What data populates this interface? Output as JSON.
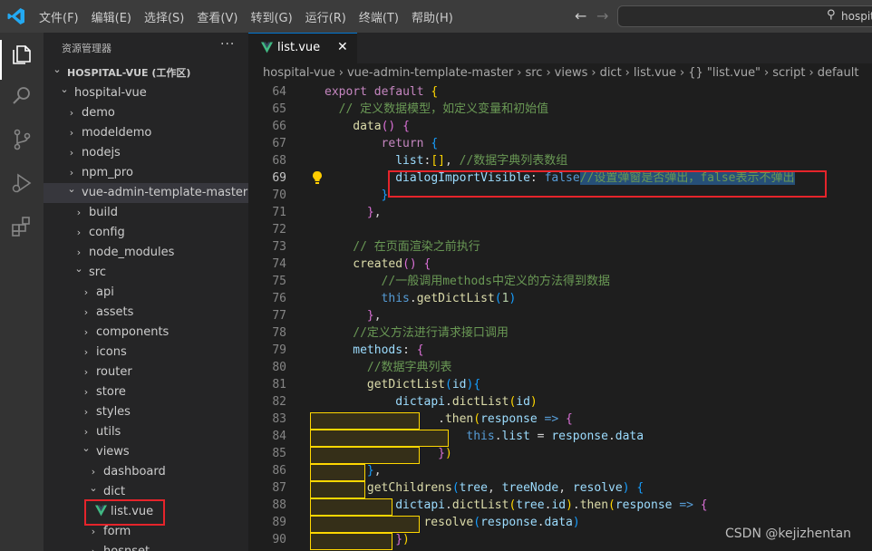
{
  "menu": {
    "items": [
      "文件(F)",
      "编辑(E)",
      "选择(S)",
      "查看(V)",
      "转到(G)",
      "运行(R)",
      "终端(T)",
      "帮助(H)"
    ]
  },
  "search": {
    "text": "hospit"
  },
  "sidebar": {
    "header": "资源管理器",
    "items": [
      {
        "label": "HOSPITAL-VUE (工作区)",
        "depth": 0,
        "expanded": true,
        "root": true
      },
      {
        "label": "hospital-vue",
        "depth": 1,
        "expanded": true
      },
      {
        "label": "demo",
        "depth": 2,
        "expanded": false
      },
      {
        "label": "modeldemo",
        "depth": 2,
        "expanded": false
      },
      {
        "label": "nodejs",
        "depth": 2,
        "expanded": false
      },
      {
        "label": "npm_pro",
        "depth": 2,
        "expanded": false
      },
      {
        "label": "vue-admin-template-master",
        "depth": 2,
        "expanded": true,
        "selected": true
      },
      {
        "label": "build",
        "depth": 3,
        "expanded": false
      },
      {
        "label": "config",
        "depth": 3,
        "expanded": false
      },
      {
        "label": "node_modules",
        "depth": 3,
        "expanded": false
      },
      {
        "label": "src",
        "depth": 3,
        "expanded": true
      },
      {
        "label": "api",
        "depth": 4,
        "expanded": false
      },
      {
        "label": "assets",
        "depth": 4,
        "expanded": false
      },
      {
        "label": "components",
        "depth": 4,
        "expanded": false
      },
      {
        "label": "icons",
        "depth": 4,
        "expanded": false
      },
      {
        "label": "router",
        "depth": 4,
        "expanded": false
      },
      {
        "label": "store",
        "depth": 4,
        "expanded": false
      },
      {
        "label": "styles",
        "depth": 4,
        "expanded": false
      },
      {
        "label": "utils",
        "depth": 4,
        "expanded": false
      },
      {
        "label": "views",
        "depth": 4,
        "expanded": true
      },
      {
        "label": "dashboard",
        "depth": 5,
        "expanded": false
      },
      {
        "label": "dict",
        "depth": 5,
        "expanded": true
      },
      {
        "label": "list.vue",
        "depth": 6,
        "file": true
      },
      {
        "label": "form",
        "depth": 5,
        "expanded": false
      },
      {
        "label": "hosnset",
        "depth": 5,
        "expanded": false
      }
    ]
  },
  "tab": {
    "label": "list.vue",
    "close": "✕"
  },
  "breadcrumbs": [
    "hospital-vue",
    "›",
    "vue-admin-template-master",
    "›",
    "src",
    "›",
    "views",
    "›",
    "dict",
    "›",
    "list.vue",
    "›",
    "{} \"list.vue\"",
    "›",
    "script",
    "›",
    "default"
  ],
  "code": {
    "current_line": 69,
    "lines": [
      {
        "n": "64",
        "tokens": [
          [
            "kw",
            "export"
          ],
          [
            "pun",
            " "
          ],
          [
            "kw",
            "default"
          ],
          [
            "pun",
            " "
          ],
          [
            "br1",
            "{"
          ]
        ],
        "indent": 0
      },
      {
        "n": "65",
        "tokens": [
          [
            "cm",
            "// 定义数据模型，如定义变量和初始值"
          ]
        ],
        "indent": 2
      },
      {
        "n": "66",
        "tokens": [
          [
            "fn",
            "data"
          ],
          [
            "br2",
            "()"
          ],
          [
            "pun",
            " "
          ],
          [
            "br2",
            "{"
          ]
        ],
        "indent": 4
      },
      {
        "n": "67",
        "tokens": [
          [
            "kw",
            "return"
          ],
          [
            "pun",
            " "
          ],
          [
            "br3",
            "{"
          ]
        ],
        "indent": 8
      },
      {
        "n": "68",
        "tokens": [
          [
            "var",
            "list"
          ],
          [
            "pun",
            ":"
          ],
          [
            "br1",
            "[]"
          ],
          [
            "pun",
            ", "
          ],
          [
            "cm",
            "//数据字典列表数组"
          ]
        ],
        "indent": 10
      },
      {
        "n": "69",
        "tokens": [
          [
            "var",
            "dialogImportVisible"
          ],
          [
            "pun",
            ": "
          ],
          [
            "kw2",
            "false"
          ],
          [
            "cm sel-txt",
            "//设置弹窗是否弹出，false表示不弹出"
          ]
        ],
        "indent": 10
      },
      {
        "n": "70",
        "tokens": [
          [
            "br3",
            "}"
          ]
        ],
        "indent": 8
      },
      {
        "n": "71",
        "tokens": [
          [
            "br2",
            "}"
          ],
          [
            "pun",
            ","
          ]
        ],
        "indent": 6
      },
      {
        "n": "72",
        "tokens": [],
        "indent": 0
      },
      {
        "n": "73",
        "tokens": [
          [
            "cm",
            "// 在页面渲染之前执行"
          ]
        ],
        "indent": 4
      },
      {
        "n": "74",
        "tokens": [
          [
            "fn",
            "created"
          ],
          [
            "br2",
            "()"
          ],
          [
            "pun",
            " "
          ],
          [
            "br2",
            "{"
          ]
        ],
        "indent": 4
      },
      {
        "n": "75",
        "tokens": [
          [
            "cm",
            "//一般调用methods中定义的方法得到数据"
          ]
        ],
        "indent": 8
      },
      {
        "n": "76",
        "tokens": [
          [
            "kw2",
            "this"
          ],
          [
            "pun",
            "."
          ],
          [
            "fn",
            "getDictList"
          ],
          [
            "br3",
            "("
          ],
          [
            "num",
            "1"
          ],
          [
            "br3",
            ")"
          ]
        ],
        "indent": 8
      },
      {
        "n": "77",
        "tokens": [
          [
            "br2",
            "}"
          ],
          [
            "pun",
            ","
          ]
        ],
        "indent": 6
      },
      {
        "n": "78",
        "tokens": [
          [
            "cm",
            "//定义方法进行请求接口调用"
          ]
        ],
        "indent": 4
      },
      {
        "n": "79",
        "tokens": [
          [
            "var",
            "methods"
          ],
          [
            "pun",
            ": "
          ],
          [
            "br2",
            "{"
          ]
        ],
        "indent": 4
      },
      {
        "n": "80",
        "tokens": [
          [
            "cm",
            "//数据字典列表"
          ]
        ],
        "indent": 6
      },
      {
        "n": "81",
        "tokens": [
          [
            "fn",
            "getDictList"
          ],
          [
            "br3",
            "("
          ],
          [
            "var",
            "id"
          ],
          [
            "br3",
            ")"
          ],
          [
            "br3",
            "{"
          ]
        ],
        "indent": 6
      },
      {
        "n": "82",
        "tokens": [
          [
            "var",
            "dictapi"
          ],
          [
            "pun",
            "."
          ],
          [
            "fn",
            "dictList"
          ],
          [
            "br1",
            "("
          ],
          [
            "var",
            "id"
          ],
          [
            "br1",
            ")"
          ]
        ],
        "indent": 10
      },
      {
        "n": "83",
        "tokens": [
          [
            "pun",
            "."
          ],
          [
            "fn",
            "then"
          ],
          [
            "br1",
            "("
          ],
          [
            "var",
            "response"
          ],
          [
            "pun",
            " "
          ],
          [
            "kw2",
            "=>"
          ],
          [
            "pun",
            " "
          ],
          [
            "br2",
            "{"
          ]
        ],
        "indent": 16
      },
      {
        "n": "84",
        "tokens": [
          [
            "kw2",
            "this"
          ],
          [
            "pun",
            "."
          ],
          [
            "var",
            "list"
          ],
          [
            "pun",
            " = "
          ],
          [
            "var",
            "response"
          ],
          [
            "pun",
            "."
          ],
          [
            "var",
            "data"
          ]
        ],
        "indent": 20
      },
      {
        "n": "85",
        "tokens": [
          [
            "br2",
            "}"
          ],
          [
            "br1",
            ")"
          ]
        ],
        "indent": 16
      },
      {
        "n": "86",
        "tokens": [
          [
            "br3",
            "}"
          ],
          [
            "pun",
            ","
          ]
        ],
        "indent": 6
      },
      {
        "n": "87",
        "tokens": [
          [
            "fn",
            "getChildrens"
          ],
          [
            "br3",
            "("
          ],
          [
            "var",
            "tree"
          ],
          [
            "pun",
            ", "
          ],
          [
            "var",
            "treeNode"
          ],
          [
            "pun",
            ", "
          ],
          [
            "var",
            "resolve"
          ],
          [
            "br3",
            ")"
          ],
          [
            "pun",
            " "
          ],
          [
            "br3",
            "{"
          ]
        ],
        "indent": 6
      },
      {
        "n": "88",
        "tokens": [
          [
            "var",
            "dictapi"
          ],
          [
            "pun",
            "."
          ],
          [
            "fn",
            "dictList"
          ],
          [
            "br1",
            "("
          ],
          [
            "var",
            "tree"
          ],
          [
            "pun",
            "."
          ],
          [
            "var",
            "id"
          ],
          [
            "br1",
            ")"
          ],
          [
            "pun",
            "."
          ],
          [
            "fn",
            "then"
          ],
          [
            "br1",
            "("
          ],
          [
            "var",
            "response"
          ],
          [
            "pun",
            " "
          ],
          [
            "kw2",
            "=>"
          ],
          [
            "pun",
            " "
          ],
          [
            "br2",
            "{"
          ]
        ],
        "indent": 10
      },
      {
        "n": "89",
        "tokens": [
          [
            "fn",
            "resolve"
          ],
          [
            "br3",
            "("
          ],
          [
            "var",
            "response"
          ],
          [
            "pun",
            "."
          ],
          [
            "var",
            "data"
          ],
          [
            "br3",
            ")"
          ]
        ],
        "indent": 14
      },
      {
        "n": "90",
        "tokens": [
          [
            "br2",
            "}"
          ],
          [
            "br1",
            ")"
          ]
        ],
        "indent": 10
      }
    ]
  },
  "watermark": "CSDN @kejizhentan",
  "colors": {
    "accent": "#0078d4",
    "highlight_box": "#e5242b",
    "vue_green": "#41b883"
  }
}
